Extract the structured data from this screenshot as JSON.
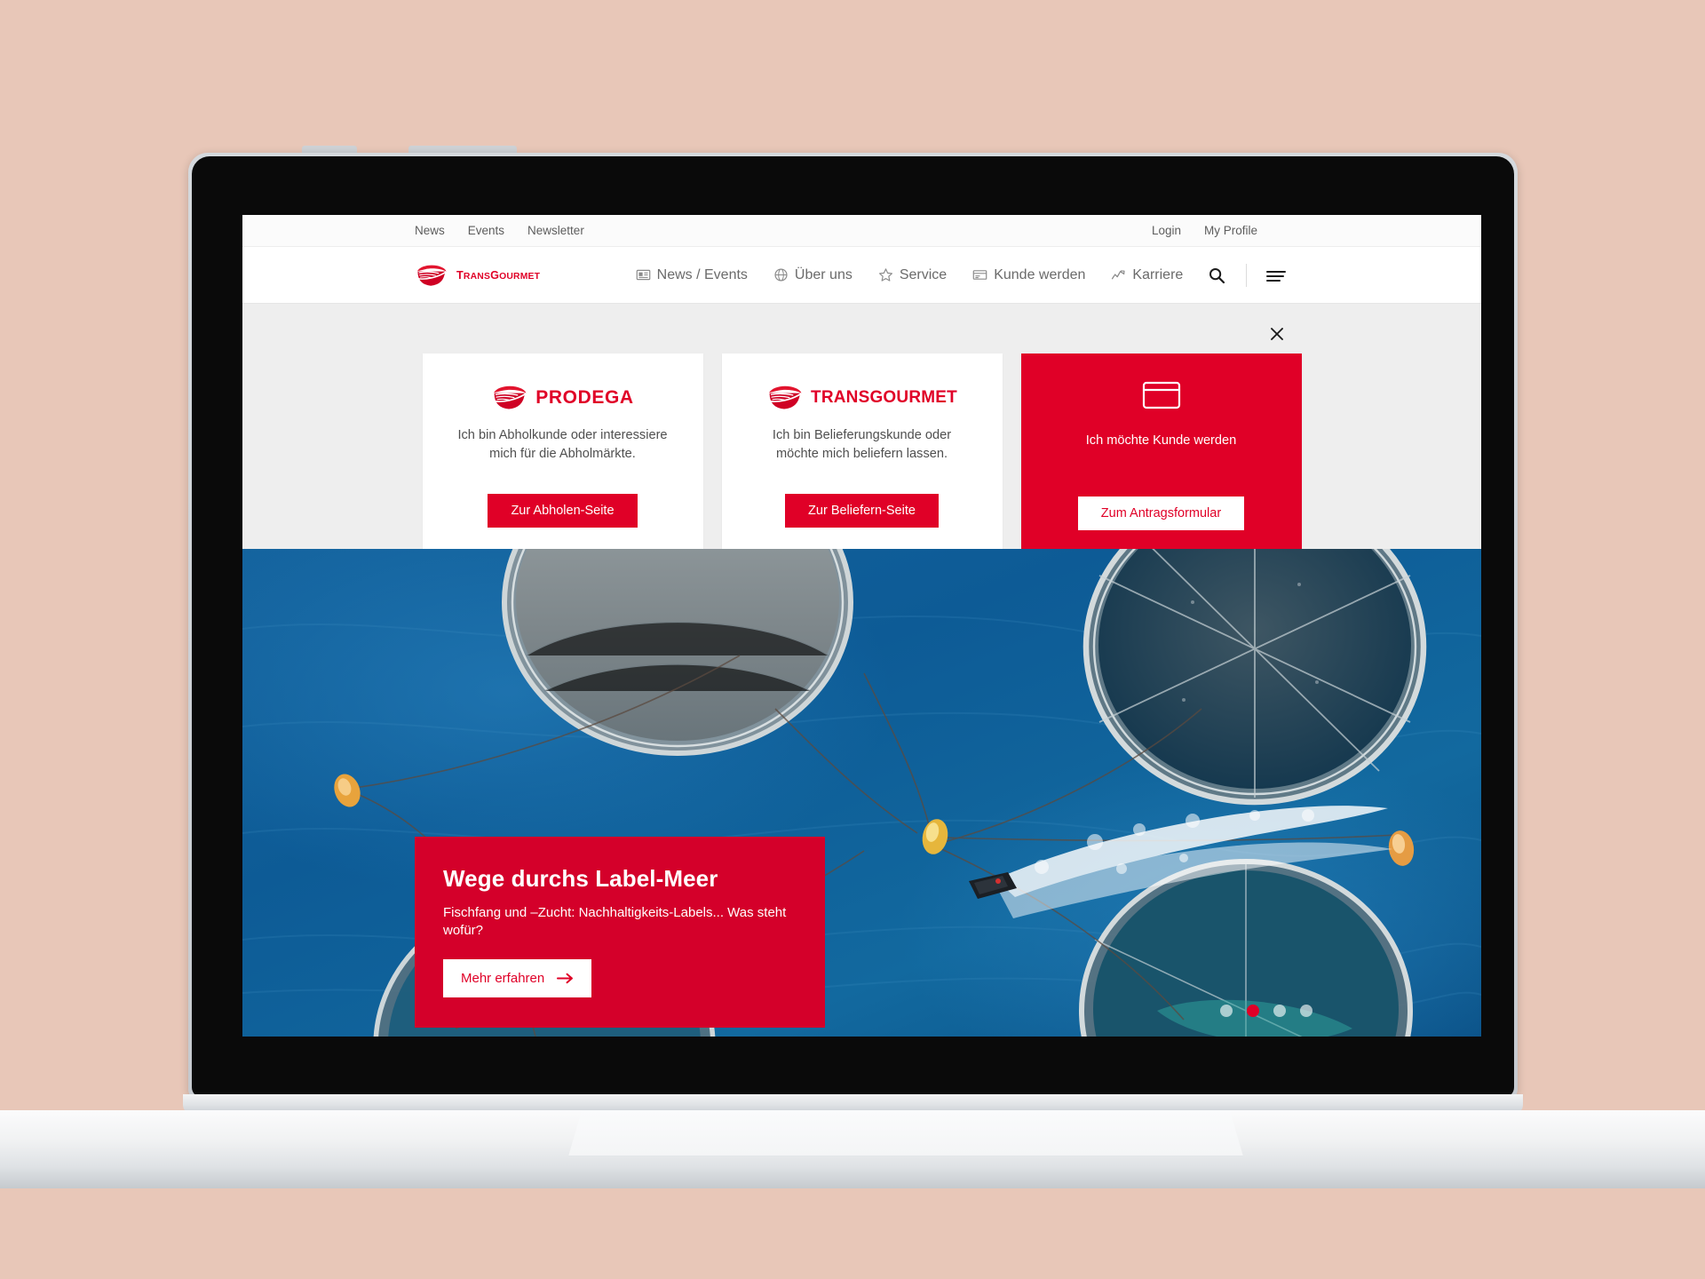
{
  "utility_bar": {
    "left_links": [
      "News",
      "Events",
      "Newsletter"
    ],
    "right_links": [
      "Login",
      "My Profile"
    ]
  },
  "brand": {
    "name": "TRANSGOURMET",
    "name_prefix": "TRANS",
    "name_suffix": "GOURMET",
    "color": "#E00027"
  },
  "main_nav": {
    "items": [
      {
        "label": "News / Events",
        "icon": "news-card-icon"
      },
      {
        "label": "Über uns",
        "icon": "globe-icon"
      },
      {
        "label": "Service",
        "icon": "star-icon"
      },
      {
        "label": "Kunde werden",
        "icon": "id-card-icon"
      },
      {
        "label": "Karriere",
        "icon": "chart-line-icon"
      }
    ],
    "search_icon": "search-icon",
    "menu_icon": "hamburger-menu-icon"
  },
  "chooser": {
    "close_icon": "close-icon",
    "background": "#EEEEEE",
    "cards": [
      {
        "logo_text": "PRODEGA",
        "logo_prefix": "PRODE",
        "logo_suffix": "GA",
        "icon": "transgourmet-bowl-logo-icon",
        "description": "Ich bin Abholkunde oder interessiere mich für die Abholmärkte.",
        "button_label": "Zur Abholen-Seite",
        "style": "white"
      },
      {
        "logo_text": "TRANSGOURMET",
        "logo_prefix": "TRANS",
        "logo_suffix": "GOURMET",
        "icon": "transgourmet-bowl-logo-icon",
        "description": "Ich bin Belieferungskunde oder möchte mich beliefern lassen.",
        "button_label": "Zur Beliefern-Seite",
        "style": "white"
      },
      {
        "logo_text": "",
        "icon": "credit-card-icon",
        "description": "Ich möchte Kunde werden",
        "button_label": "Zum Antragsformular",
        "style": "red"
      }
    ]
  },
  "hero": {
    "image_description": "Luftaufnahme einer Fischfarm mit runden Netzgehegen im blauen Meer und einem Boot",
    "teaser": {
      "title": "Wege durchs Label-Meer",
      "subtitle": "Fischfang und –Zucht: Nachhaltigkeits-Labels... Was steht wofür?",
      "button_label": "Mehr erfahren",
      "button_icon": "arrow-right-icon",
      "background": "#D4002A"
    },
    "carousel": {
      "slide_count": 4,
      "active_index": 1
    }
  },
  "page_background": "#E8C7B8"
}
